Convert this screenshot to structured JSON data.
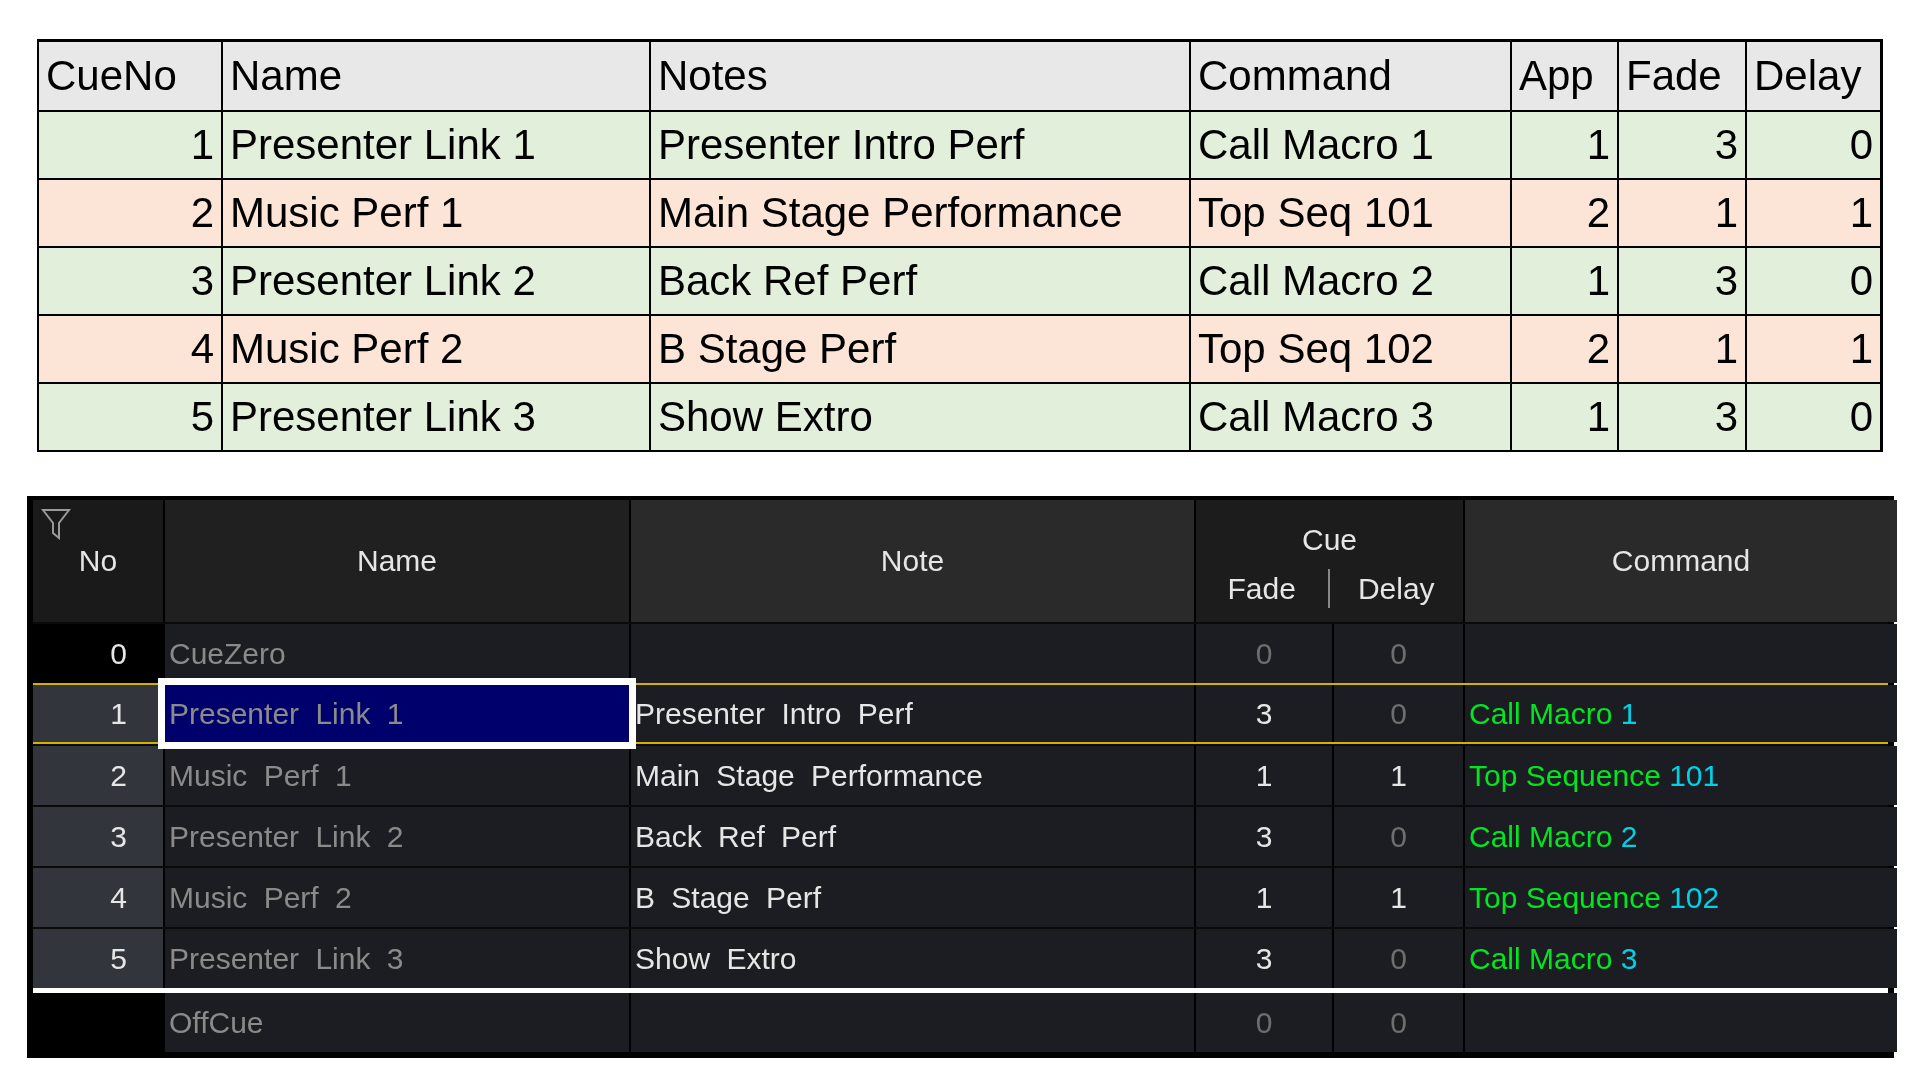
{
  "spreadsheet": {
    "columns": [
      "CueNo",
      "Name",
      "Notes",
      "Command",
      "App",
      "Fade",
      "Delay"
    ],
    "rows": [
      {
        "color": "#e2efda",
        "cells": [
          "1",
          "Presenter Link 1",
          "Presenter Intro Perf",
          "Call Macro 1",
          "1",
          "3",
          "0"
        ]
      },
      {
        "color": "#fce4d6",
        "cells": [
          "2",
          "Music Perf 1",
          "Main Stage Performance",
          "Top Seq 101",
          "2",
          "1",
          "1"
        ]
      },
      {
        "color": "#e2efda",
        "cells": [
          "3",
          "Presenter Link 2",
          "Back Ref Perf",
          "Call Macro 2",
          "1",
          "3",
          "0"
        ]
      },
      {
        "color": "#fce4d6",
        "cells": [
          "4",
          "Music Perf 2",
          "B Stage Perf",
          "Top Seq 102",
          "2",
          "1",
          "1"
        ]
      },
      {
        "color": "#e2efda",
        "cells": [
          "5",
          "Presenter Link 3",
          "Show Extro",
          "Call Macro 3",
          "1",
          "3",
          "0"
        ]
      }
    ]
  },
  "cue_list": {
    "headers": {
      "no": "No",
      "name": "Name",
      "note": "Note",
      "cue": "Cue",
      "fade": "Fade",
      "delay": "Delay",
      "command": "Command"
    },
    "rows": [
      {
        "kind": "cue_zero",
        "no": "0",
        "name": "CueZero",
        "fade": "0",
        "fade_dim": true,
        "delay": "0",
        "delay_dim": true
      },
      {
        "kind": "cue",
        "no": "1",
        "name": "Presenter Link 1",
        "selected": true,
        "current": true,
        "note": "Presenter Intro Perf",
        "fade": "3",
        "fade_dim": false,
        "delay": "0",
        "delay_dim": true,
        "command": "Call Macro",
        "target": "1"
      },
      {
        "kind": "cue",
        "no": "2",
        "name": "Music Perf 1",
        "selected": false,
        "current": false,
        "note": "Main Stage Performance",
        "fade": "1",
        "fade_dim": false,
        "delay": "1",
        "delay_dim": false,
        "command": "Top Sequence",
        "target": "101"
      },
      {
        "kind": "cue",
        "no": "3",
        "name": "Presenter Link 2",
        "selected": false,
        "current": false,
        "note": "Back Ref Perf",
        "fade": "3",
        "fade_dim": false,
        "delay": "0",
        "delay_dim": true,
        "command": "Call Macro",
        "target": "2"
      },
      {
        "kind": "cue",
        "no": "4",
        "name": "Music Perf 2",
        "selected": false,
        "current": false,
        "note": "B Stage Perf",
        "fade": "1",
        "fade_dim": false,
        "delay": "1",
        "delay_dim": false,
        "command": "Top Sequence",
        "target": "102"
      },
      {
        "kind": "cue",
        "no": "5",
        "name": "Presenter Link 3",
        "selected": false,
        "current": false,
        "note": "Show Extro",
        "fade": "3",
        "fade_dim": false,
        "delay": "0",
        "delay_dim": true,
        "command": "Call Macro",
        "target": "3"
      },
      {
        "kind": "off_cue",
        "name": "OffCue",
        "fade": "0",
        "fade_dim": true,
        "delay": "0",
        "delay_dim": true
      }
    ]
  }
}
